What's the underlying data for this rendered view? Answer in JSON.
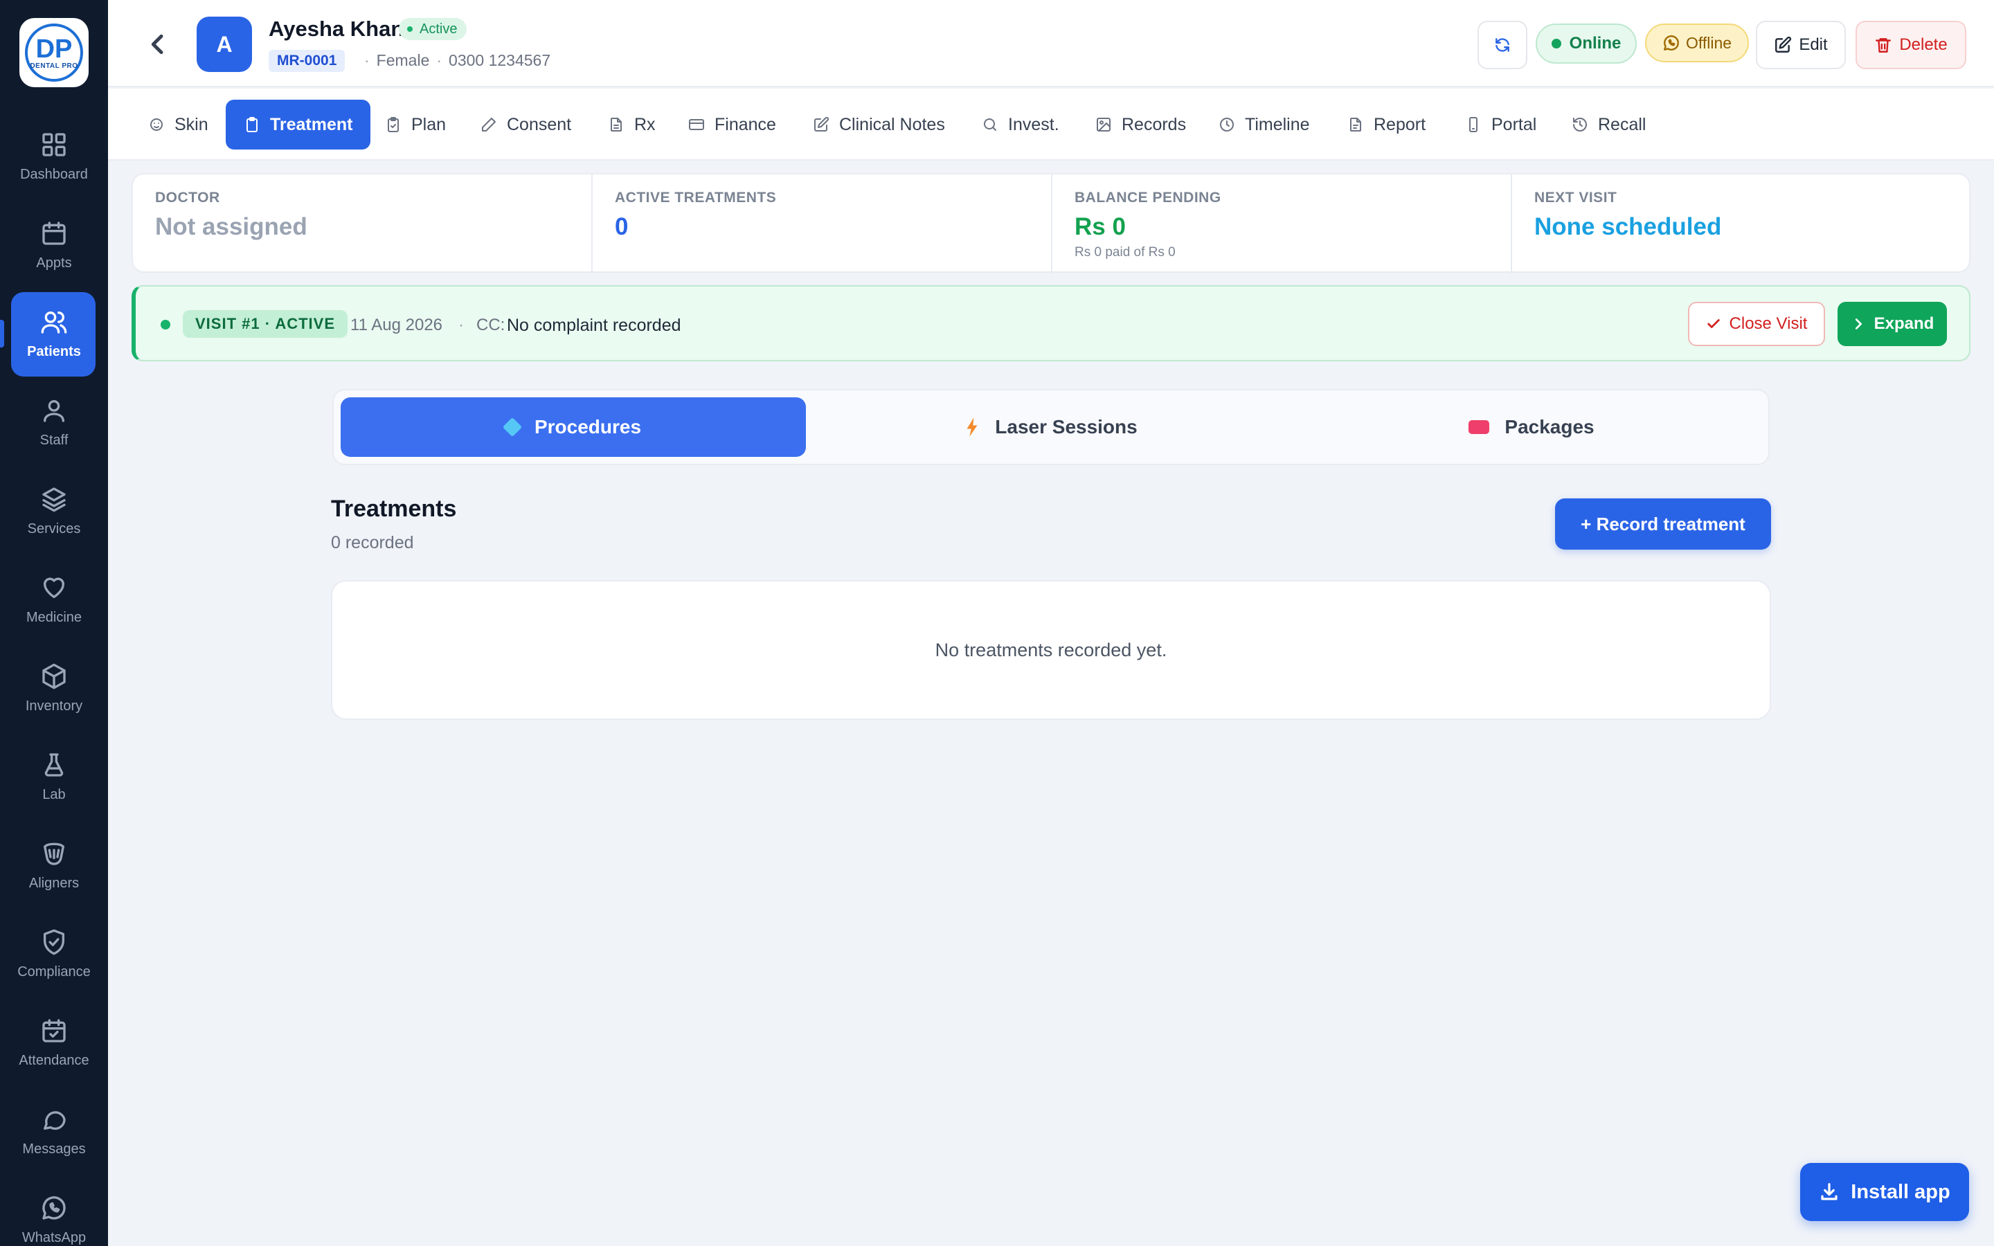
{
  "app": {
    "logo_text_main": "DP",
    "logo_text_sub": "DENTAL PRO"
  },
  "sidebar": {
    "items": [
      {
        "label": "Dashboard",
        "icon": "grid-icon"
      },
      {
        "label": "Appts",
        "icon": "calendar-icon"
      },
      {
        "label": "Patients",
        "icon": "users-icon",
        "active": true
      },
      {
        "label": "Staff",
        "icon": "user-icon"
      },
      {
        "label": "Services",
        "icon": "layers-icon"
      },
      {
        "label": "Medicine",
        "icon": "heart-icon"
      },
      {
        "label": "Inventory",
        "icon": "box-icon"
      },
      {
        "label": "Lab",
        "icon": "flask-icon"
      },
      {
        "label": "Aligners",
        "icon": "aligner-icon"
      },
      {
        "label": "Compliance",
        "icon": "shield-check-icon"
      },
      {
        "label": "Attendance",
        "icon": "calendar-check-icon"
      },
      {
        "label": "Messages",
        "icon": "message-icon"
      },
      {
        "label": "WhatsApp",
        "icon": "whatsapp-icon"
      }
    ]
  },
  "patient": {
    "avatar_letter": "A",
    "name": "Ayesha Khan",
    "status": "Active",
    "mr_number": "MR-0001",
    "gender": "Female",
    "phone": "0300 1234567"
  },
  "header": {
    "online_label": "Online",
    "offline_label": "Offline",
    "edit_label": "Edit",
    "delete_label": "Delete"
  },
  "tabs": [
    {
      "label": "Skin",
      "icon": "skin-icon"
    },
    {
      "label": "Treatment",
      "icon": "clipboard-icon",
      "active": true
    },
    {
      "label": "Plan",
      "icon": "clipboard-check-icon"
    },
    {
      "label": "Consent",
      "icon": "pen-icon"
    },
    {
      "label": "Rx",
      "icon": "file-icon"
    },
    {
      "label": "Finance",
      "icon": "card-icon"
    },
    {
      "label": "Clinical Notes",
      "icon": "edit-icon"
    },
    {
      "label": "Invest.",
      "icon": "search-icon"
    },
    {
      "label": "Records",
      "icon": "image-icon"
    },
    {
      "label": "Timeline",
      "icon": "clock-icon"
    },
    {
      "label": "Report",
      "icon": "document-icon"
    },
    {
      "label": "Portal",
      "icon": "phone-icon"
    },
    {
      "label": "Recall",
      "icon": "history-icon"
    }
  ],
  "summary": {
    "doctor": {
      "label": "DOCTOR",
      "value": "Not assigned"
    },
    "active_treatments": {
      "label": "ACTIVE TREATMENTS",
      "value": "0"
    },
    "balance": {
      "label": "BALANCE PENDING",
      "value": "Rs 0",
      "sub": "Rs 0 paid of Rs 0"
    },
    "next_visit": {
      "label": "NEXT VISIT",
      "value": "None scheduled"
    }
  },
  "visit": {
    "badge": "VISIT #1 · ACTIVE",
    "date": "11 Aug 2026",
    "sep": "·",
    "cc_label": "CC:",
    "cc_value": "No complaint recorded",
    "close_label": "Close Visit",
    "expand_label": "Expand"
  },
  "subtabs": [
    {
      "label": "Procedures",
      "active": true
    },
    {
      "label": "Laser Sessions"
    },
    {
      "label": "Packages"
    }
  ],
  "treatments": {
    "title": "Treatments",
    "count": "0 recorded",
    "record_button": "+ Record treatment",
    "empty_message": "No treatments recorded yet."
  },
  "install": {
    "label": "Install app"
  },
  "colors": {
    "sidebar_bg": "#0f1b2d",
    "accent": "#2a64e6",
    "success": "#18b26b",
    "danger": "#d21f1f",
    "next_visit": "#1aa0e0",
    "balance": "#13a14f"
  }
}
